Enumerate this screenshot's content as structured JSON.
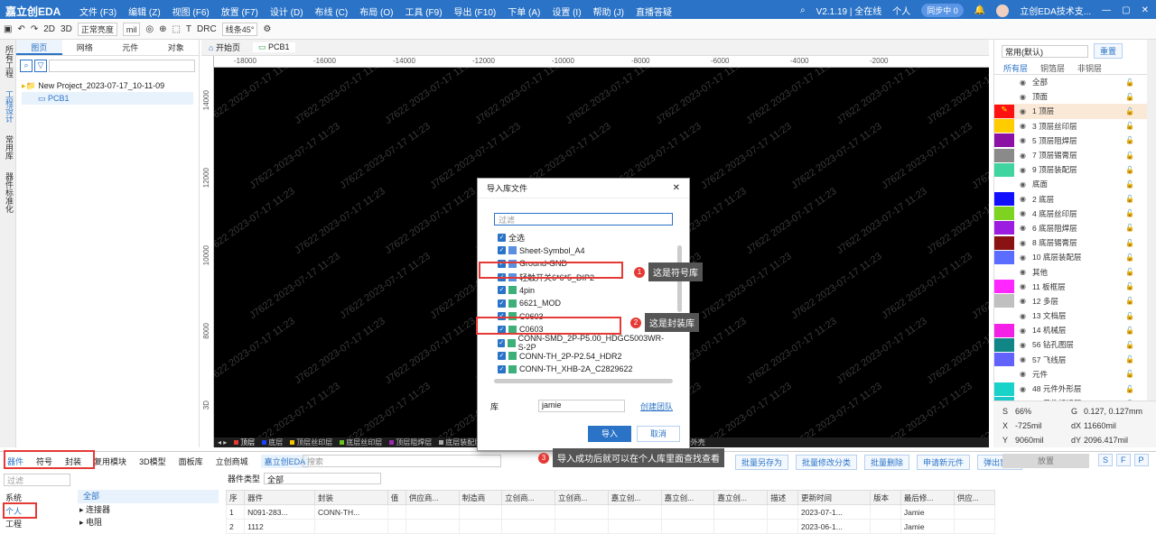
{
  "app": {
    "logo": "嘉立创EDA",
    "menu": [
      "文件 (F3)",
      "编辑 (Z)",
      "视图 (F6)",
      "放置 (F7)",
      "设计 (D)",
      "布线 (C)",
      "布局 (O)",
      "工具 (F9)",
      "导出 (F10)",
      "下单 (A)",
      "设置 (I)",
      "帮助 (J)",
      "直播答疑"
    ],
    "version": "V2.1.19 | 全在线",
    "user_mode": "个人",
    "sync": "同步中 0",
    "account": "立创EDA技术支..."
  },
  "toolbar": {
    "view2d": "2D",
    "view3d": "3D",
    "brightness": "正常亮度",
    "unit": "mil",
    "line_style": "线条45°"
  },
  "left_strip": [
    "所有工程",
    "工程设计",
    "常用库",
    "器件标准化"
  ],
  "left_panel": {
    "tabs": [
      "图页",
      "网络",
      "元件",
      "对象"
    ],
    "project": "New Project_2023-07-17_10-11-09",
    "pcb": "PCB1"
  },
  "doc_tabs": [
    "开始页",
    "PCB1"
  ],
  "ruler_top": [
    "-18000",
    "-16000",
    "-14000",
    "-12000",
    "-10000",
    "-8000",
    "-6000",
    "-4000",
    "-2000"
  ],
  "ruler_left": [
    "14000",
    "12000",
    "10000",
    "8000",
    "3D"
  ],
  "watermark": "J7622   2023-07-17   11:23",
  "layer_bar": [
    {
      "name": "顶层",
      "color": "#e53935"
    },
    {
      "name": "底层",
      "color": "#1e40ff"
    },
    {
      "name": "顶层丝印层",
      "color": "#f5c400"
    },
    {
      "name": "底层丝印层",
      "color": "#6bc31e"
    },
    {
      "name": "顶层阻焊层",
      "color": "#9c27b0"
    },
    {
      "name": "底层装配层",
      "color": "#aaaaaa"
    },
    {
      "name": "板框层",
      "color": "#e040fb"
    },
    {
      "name": "多层",
      "color": "#aaaaaa"
    },
    {
      "name": "文档层",
      "color": "#ffffff"
    },
    {
      "name": "机械层",
      "color": "#e040fb"
    },
    {
      "name": "3D外壳边框层",
      "color": "#43a047"
    },
    {
      "name": "3D外壳"
    }
  ],
  "right_panel": {
    "select": "常用(默认)",
    "reset": "重置",
    "tabs": [
      "所有层",
      "铜箔层",
      "非铜层"
    ],
    "layers": [
      {
        "label": "全部",
        "color": ""
      },
      {
        "label": "顶面",
        "color": "",
        "group": true
      },
      {
        "label": "1 顶层",
        "color": "#ff1111",
        "active": true
      },
      {
        "label": "3 顶层丝印层",
        "color": "#ffcc00"
      },
      {
        "label": "5 顶层阻焊层",
        "color": "#8b12a4"
      },
      {
        "label": "7 顶层锡膏层",
        "color": "#8a8a8a"
      },
      {
        "label": "9 顶层装配层",
        "color": "#3fd4a0"
      },
      {
        "label": "底面",
        "color": "",
        "group": true
      },
      {
        "label": "2 底层",
        "color": "#1010ff"
      },
      {
        "label": "4 底层丝印层",
        "color": "#7ed321"
      },
      {
        "label": "6 底层阻焊层",
        "color": "#9a1de0"
      },
      {
        "label": "8 底层锡膏层",
        "color": "#8a1212"
      },
      {
        "label": "10 底层装配层",
        "color": "#5a6dff"
      },
      {
        "label": "其他",
        "color": "",
        "group": true
      },
      {
        "label": "11 板框层",
        "color": "#ff26ff"
      },
      {
        "label": "12 多层",
        "color": "#c0c0c0"
      },
      {
        "label": "13 文档层",
        "color": "#ffffff"
      },
      {
        "label": "14 机械层",
        "color": "#f520e6"
      },
      {
        "label": "56 钻孔图层",
        "color": "#108686"
      },
      {
        "label": "57 飞线层",
        "color": "#6262ff"
      },
      {
        "label": "元件",
        "color": "",
        "group": true
      },
      {
        "label": "48 元件外形层",
        "color": "#19d2c8"
      },
      {
        "label": "49 元件标识层",
        "color": "#1cc8c8"
      }
    ]
  },
  "coords": {
    "s_label": "S",
    "s": "66%",
    "g_label": "G",
    "g": "0.127, 0.127mm",
    "x_label": "X",
    "x": "-725mil",
    "dx_label": "dX",
    "dx": "11660mil",
    "y_label": "Y",
    "y": "9060mil",
    "dy_label": "dY",
    "dy": "2096.417mil"
  },
  "bottom": {
    "tabs": [
      "器件",
      "符号",
      "封装",
      "复用模块",
      "3D模型",
      "面板库",
      "立创商城",
      "嘉立创EDA"
    ],
    "search_placeholder": "搜索",
    "filter_placeholder": "过滤",
    "actions": [
      "批量另存为",
      "批量修改分类",
      "批量删除",
      "申请新元件",
      "弹出窗口"
    ],
    "cat_label": "器件类型",
    "cat_value": "全部",
    "side": [
      "系统",
      "个人",
      "工程"
    ],
    "tree": [
      "全部",
      "连接器",
      "电阻"
    ],
    "columns": [
      "序",
      "器件",
      "封装",
      "值",
      "供应商...",
      "制造商",
      "立创商...",
      "立创商...",
      "嘉立创...",
      "嘉立创...",
      "嘉立创...",
      "描述",
      "更新时间",
      "版本",
      "最后修...",
      "供应..."
    ],
    "rows": [
      [
        "1",
        "N091-283...",
        "CONN-TH...",
        "",
        "",
        "",
        "",
        "",
        "",
        "",
        "",
        "",
        "2023-07-1...",
        "",
        "Jamie",
        ""
      ],
      [
        "2",
        "1112",
        "",
        "",
        "",
        "",
        "",
        "",
        "",
        "",
        "",
        "",
        "2023-06-1...",
        "",
        "Jamie",
        ""
      ]
    ],
    "right_btn": "放置",
    "right_keys": [
      "S",
      "F",
      "P"
    ]
  },
  "dialog": {
    "title": "导入库文件",
    "filter_placeholder": "过滤",
    "select_all": "全选",
    "items": [
      {
        "name": "Sheet-Symbol_A4",
        "kind": "sym"
      },
      {
        "name": "Ground-GND",
        "kind": "sym"
      },
      {
        "name": "轻触开关6*6*5_DIP2",
        "kind": "sym"
      },
      {
        "name": "4pin",
        "kind": "fp"
      },
      {
        "name": "6621_MOD",
        "kind": "fp"
      },
      {
        "name": "C0603",
        "kind": "fp"
      },
      {
        "name": "C0603",
        "kind": "fp"
      },
      {
        "name": "CONN-SMD_2P-P5.00_HDGC5003WR-S-2P",
        "kind": "fp"
      },
      {
        "name": "CONN-TH_2P-P2.54_HDR2",
        "kind": "fp"
      },
      {
        "name": "CONN-TH_XHB-2A_C2829622",
        "kind": "fp"
      }
    ],
    "lib_label": "库",
    "lib_value": "jamie",
    "create_team": "创建团队",
    "import": "导入",
    "cancel": "取消"
  },
  "callouts": [
    {
      "num": "1",
      "text": "这是符号库"
    },
    {
      "num": "2",
      "text": "这是封装库"
    },
    {
      "num": "3",
      "text": "导入成功后就可以在个人库里面查找查看"
    }
  ]
}
